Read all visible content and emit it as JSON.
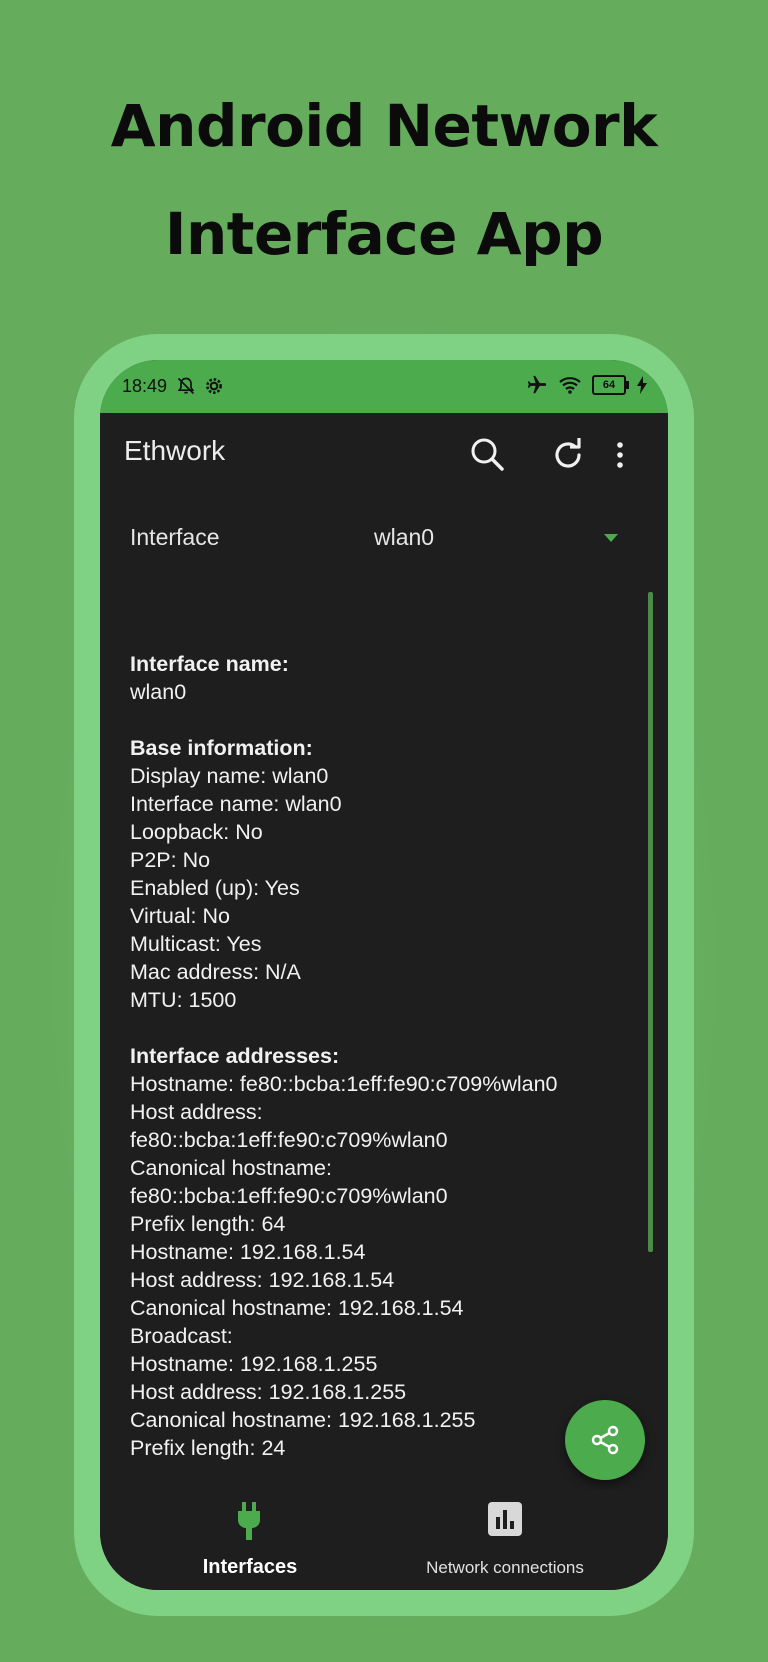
{
  "headline": {
    "line1": "Android Network",
    "line2": "Interface App"
  },
  "status_bar": {
    "time": "18:49",
    "battery": "64"
  },
  "app_bar": {
    "title": "Ethwork"
  },
  "selector": {
    "label": "Interface",
    "value": "wlan0"
  },
  "content": {
    "interface_name_title": "Interface name:",
    "interface_name_value": "wlan0",
    "base_info_title": "Base information:",
    "base_info": [
      "Display name: wlan0",
      "Interface name: wlan0",
      "Loopback: No",
      "P2P: No",
      "Enabled (up): Yes",
      "Virtual: No",
      "Multicast: Yes",
      "Mac address: N/A",
      "MTU: 1500"
    ],
    "addresses_title": "Interface addresses:",
    "addresses": [
      "Hostname: fe80::bcba:1eff:fe90:c709%wlan0",
      "Host address:",
      "fe80::bcba:1eff:fe90:c709%wlan0",
      "Canonical hostname:",
      "fe80::bcba:1eff:fe90:c709%wlan0",
      "Prefix length: 64",
      "Hostname: 192.168.1.54",
      "Host address: 192.168.1.54",
      "Canonical hostname: 192.168.1.54",
      "Broadcast:",
      "Hostname: 192.168.1.255",
      "Host address: 192.168.1.255",
      "Canonical hostname: 192.168.1.255",
      "Prefix length: 24"
    ]
  },
  "bottom_nav": {
    "interfaces_label": "Interfaces",
    "connections_label": "Network connections"
  },
  "colors": {
    "background": "#66ac5d",
    "accent": "#4cab4d",
    "frame": "#7fd184",
    "screen": "#1e1e1e"
  },
  "icons": {
    "status_left": [
      "bell-off-icon",
      "gear-icon"
    ],
    "status_right": [
      "airplane-icon",
      "wifi-icon",
      "battery-icon",
      "charging-icon"
    ],
    "app_actions": [
      "search-icon",
      "refresh-icon",
      "more-vertical-icon"
    ],
    "fab": "share-icon",
    "nav": [
      "plug-icon",
      "bar-chart-icon"
    ]
  }
}
